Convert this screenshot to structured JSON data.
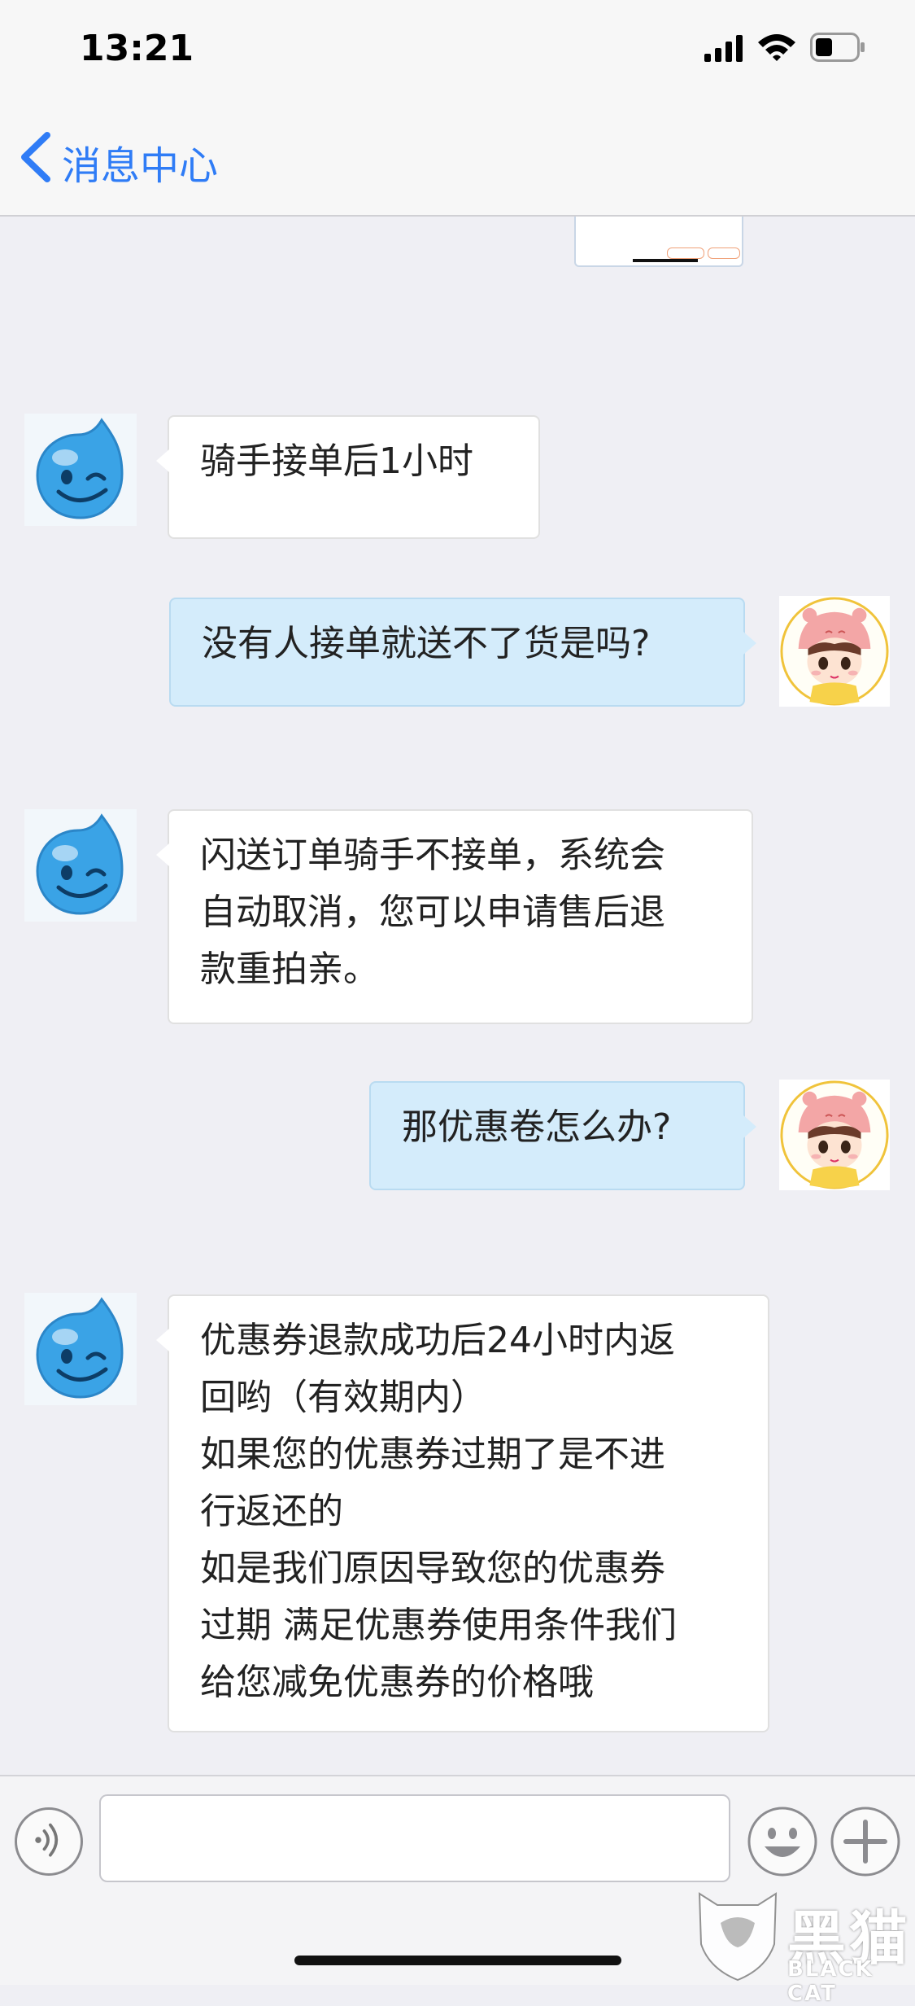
{
  "status_bar": {
    "time": "13:21"
  },
  "nav": {
    "back_label": "消息中心"
  },
  "messages": [
    {
      "side": "left",
      "text": "骑手接单后1小时"
    },
    {
      "side": "right",
      "text": "没有人接单就送不了货是吗?"
    },
    {
      "side": "left",
      "text": "闪送订单骑手不接单，系统会\n自动取消，您可以申请售后退\n款重拍亲。"
    },
    {
      "side": "right",
      "text": "那优惠卷怎么办?"
    },
    {
      "side": "left",
      "text": "优惠券退款成功后24小时内返\n回哟（有效期内）\n如果您的优惠券过期了是不进\n行返还的\n如是我们原因导致您的优惠券\n过期 满足优惠券使用条件我们\n给您减免优惠券的价格哦"
    }
  ],
  "input": {
    "value": "",
    "placeholder": ""
  },
  "watermark": {
    "cn": "黑猫",
    "en": "BLACK CAT"
  },
  "colors": {
    "accent": "#2f7cf6",
    "right_bubble": "#d4ecfb",
    "background": "#efeff4"
  },
  "icons": {
    "back": "chevron-left-icon",
    "voice": "voice-icon",
    "emoji": "smiley-icon",
    "plus": "plus-icon",
    "bot_avatar": "blue-drop-winking-avatar",
    "user_avatar": "cartoon-girl-avatar"
  }
}
